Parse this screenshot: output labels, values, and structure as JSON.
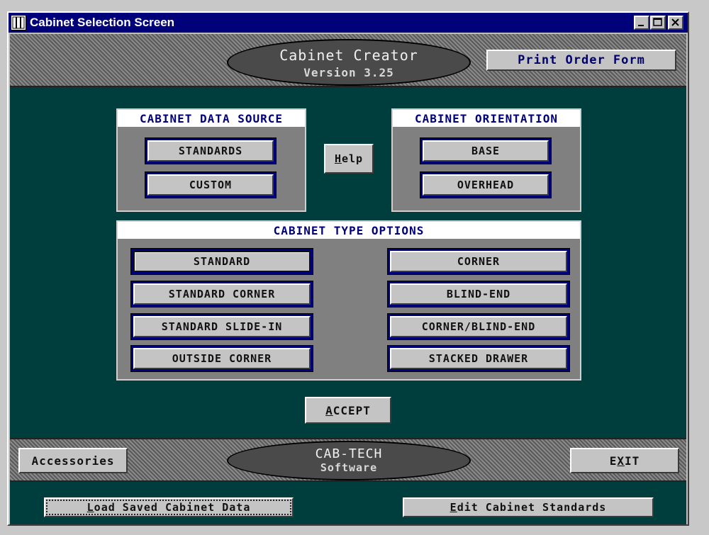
{
  "window": {
    "title": "Cabinet Selection Screen"
  },
  "header": {
    "app_name": "Cabinet Creator",
    "version": "Version 3.25",
    "print_button": "Print Order Form"
  },
  "data_source": {
    "title": "CABINET DATA SOURCE",
    "standards": "STANDARDS",
    "custom": "CUSTOM"
  },
  "help_button": {
    "prefix": "H",
    "rest": "elp"
  },
  "orientation": {
    "title": "CABINET ORIENTATION",
    "base": "BASE",
    "overhead": "OVERHEAD"
  },
  "type_options": {
    "title": "CABINET TYPE OPTIONS",
    "left": [
      "STANDARD",
      "STANDARD CORNER",
      "STANDARD SLIDE-IN",
      "OUTSIDE CORNER"
    ],
    "right": [
      "CORNER",
      "BLIND-END",
      "CORNER/BLIND-END",
      "STACKED DRAWER"
    ]
  },
  "accept_button": {
    "prefix": "A",
    "rest": "CCEPT"
  },
  "footer": {
    "accessories": "Accessories",
    "company": "CAB-TECH",
    "company_sub": "Software",
    "exit_a": "E",
    "exit_u": "X",
    "exit_b": "IT",
    "load_u": "L",
    "load_rest": "oad Saved Cabinet Data",
    "edit_u": "E",
    "edit_rest": "dit Cabinet Standards"
  },
  "colors": {
    "client_bg": "#003d3d",
    "title_bar": "#00007b",
    "panel_bg": "#808080",
    "button_face": "#c4c4c4",
    "accent_text": "#00007b"
  }
}
